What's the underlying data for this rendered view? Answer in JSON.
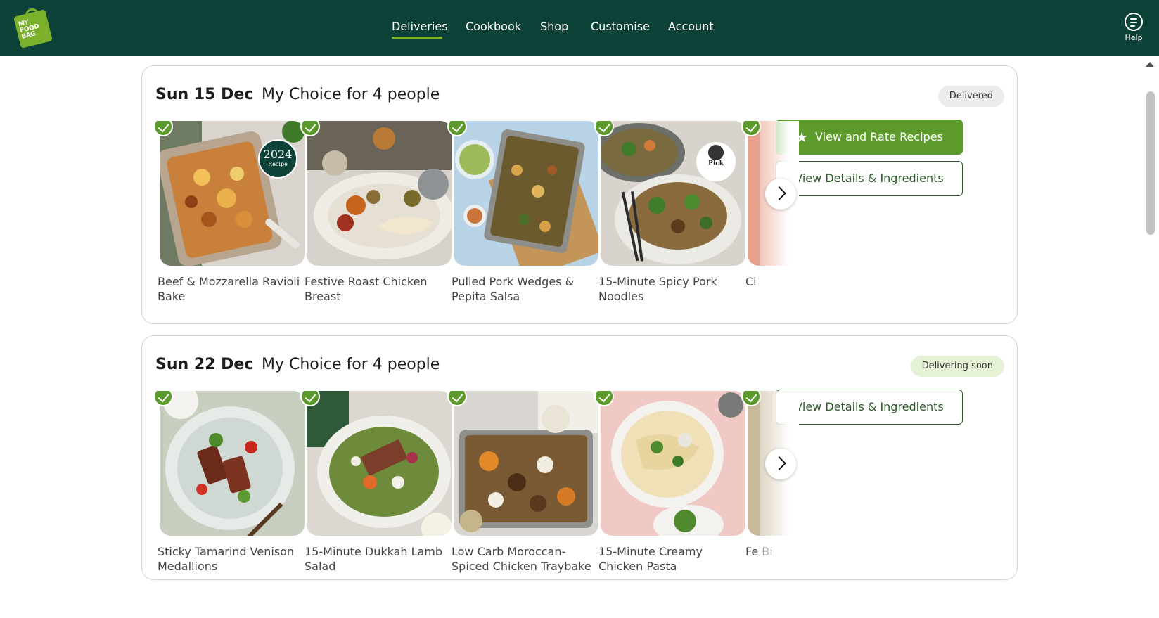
{
  "brand": {
    "logo_text": "MY FOOD BAG",
    "primary_color": "#0c4237",
    "accent_color": "#7bb12b"
  },
  "nav": {
    "items": [
      {
        "label": "Deliveries",
        "active": true
      },
      {
        "label": "Cookbook"
      },
      {
        "label": "Shop"
      },
      {
        "label": "Customise"
      },
      {
        "label": "Account"
      }
    ],
    "help_label": "Help"
  },
  "deliveries": [
    {
      "date": "Sun 15 Dec",
      "plan": "My Choice for 4 people",
      "status": "Delivered",
      "rate_button": "View and Rate Recipes",
      "details_button": "View Details & Ingredients",
      "recipes": [
        {
          "name": "Beef & Mozzarella Ravioli Bake",
          "badge": "2024",
          "badge_sub": "Recipe"
        },
        {
          "name": "Festive Roast Chicken Breast"
        },
        {
          "name": "Pulled Pork Wedges & Pepita Salsa"
        },
        {
          "name": "15-Minute Spicy Pork Noodles",
          "badge_pick": "Pick"
        },
        {
          "name": "Cl"
        }
      ]
    },
    {
      "date": "Sun 22 Dec",
      "plan": "My Choice for 4 people",
      "status": "Delivering soon",
      "details_button": "View Details & Ingredients",
      "recipes": [
        {
          "name": "Sticky Tamarind Venison Medallions"
        },
        {
          "name": "15-Minute Dukkah Lamb Salad"
        },
        {
          "name": "Low Carb Moroccan-Spiced Chicken Traybake"
        },
        {
          "name": "15-Minute Creamy Chicken Pasta"
        },
        {
          "name": "Fe Bi"
        }
      ]
    }
  ]
}
